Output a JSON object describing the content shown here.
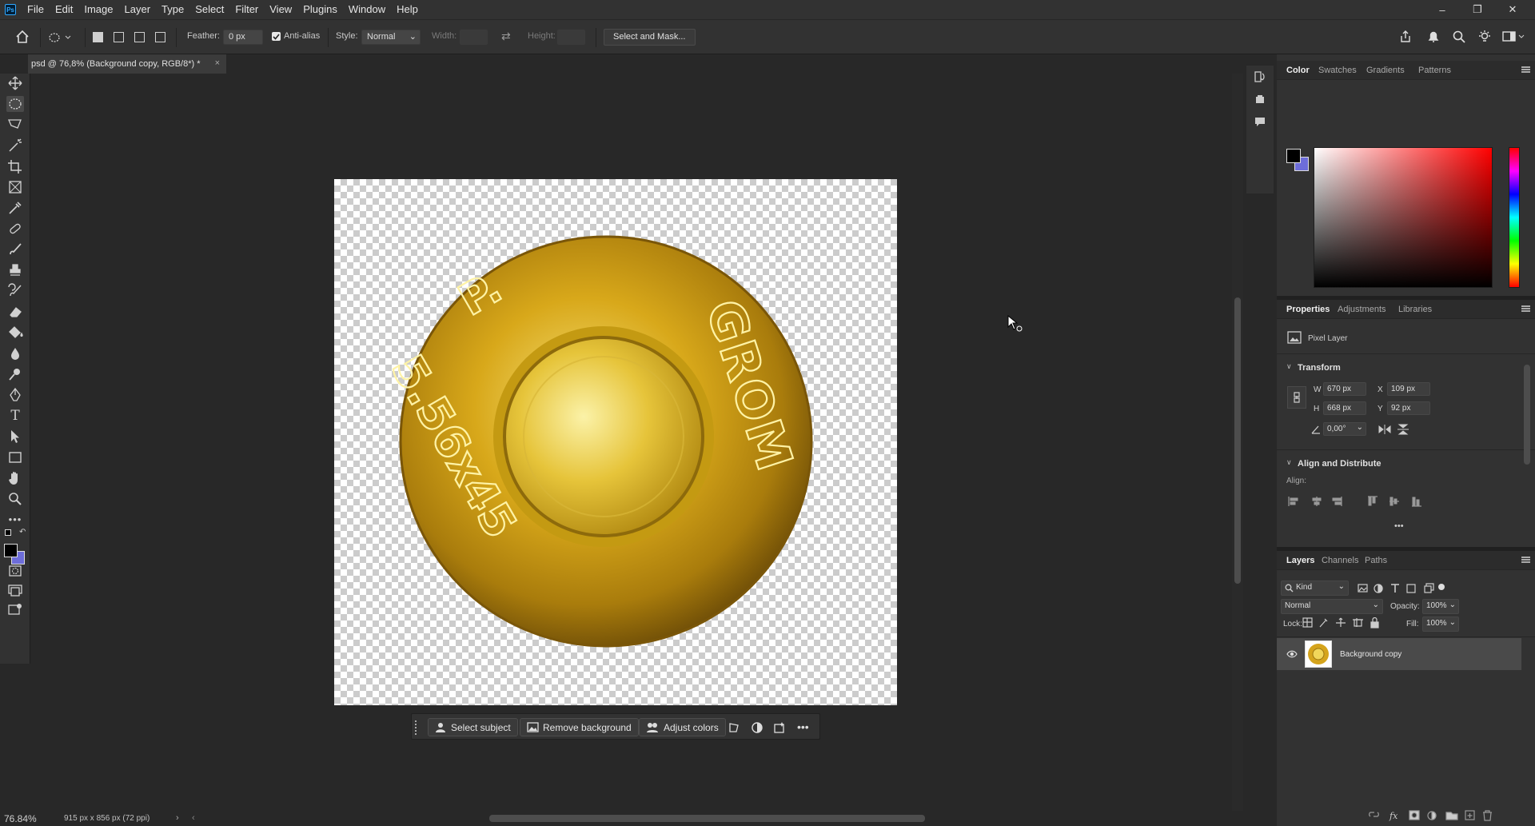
{
  "app": {
    "logo": "Ps"
  },
  "menu": [
    "File",
    "Edit",
    "Image",
    "Layer",
    "Type",
    "Select",
    "Filter",
    "View",
    "Plugins",
    "Window",
    "Help"
  ],
  "window_controls": {
    "minimize": "–",
    "restore": "❐",
    "close": "✕"
  },
  "options": {
    "feather_label": "Feather:",
    "feather_value": "0 px",
    "antialias_label": "Anti-alias",
    "antialias_checked": true,
    "style_label": "Style:",
    "style_value": "Normal",
    "width_label": "Width:",
    "height_label": "Height:",
    "select_mask_label": "Select and Mask..."
  },
  "document": {
    "tab_title": "psd @ 76,8% (Background copy, RGB/8*) *",
    "zoom": "76.84%",
    "info": "915 px x 856 px (72 ppi)"
  },
  "canvas_image": {
    "headstamp_top": "P.",
    "headstamp_right": "GROM",
    "headstamp_bottom": "5.56x45"
  },
  "contextbar": {
    "select_subject": "Select subject",
    "remove_background": "Remove background",
    "adjust_colors": "Adjust colors"
  },
  "color_panel": {
    "tabs": [
      "Color",
      "Swatches",
      "Gradients",
      "Patterns"
    ],
    "active_tab": "Color",
    "foreground": "#000000",
    "background": "#6d6dd9",
    "hue_color": "#ff0000"
  },
  "properties": {
    "tabs": [
      "Properties",
      "Adjustments",
      "Libraries"
    ],
    "layer_type": "Pixel Layer",
    "transform_label": "Transform",
    "w_label": "W",
    "w": "670 px",
    "h_label": "H",
    "h": "668 px",
    "x_label": "X",
    "x": "109 px",
    "y_label": "Y",
    "y": "92 px",
    "angle": "0,00°",
    "align_label": "Align and Distribute",
    "align_sub": "Align:"
  },
  "layers": {
    "tabs": [
      "Layers",
      "Channels",
      "Paths"
    ],
    "filter_kind": "Kind",
    "blend_mode": "Normal",
    "opacity_label": "Opacity:",
    "opacity": "100%",
    "lock_label": "Lock:",
    "fill_label": "Fill:",
    "fill": "100%",
    "items": [
      {
        "name": "Background copy",
        "visible": true
      }
    ]
  }
}
